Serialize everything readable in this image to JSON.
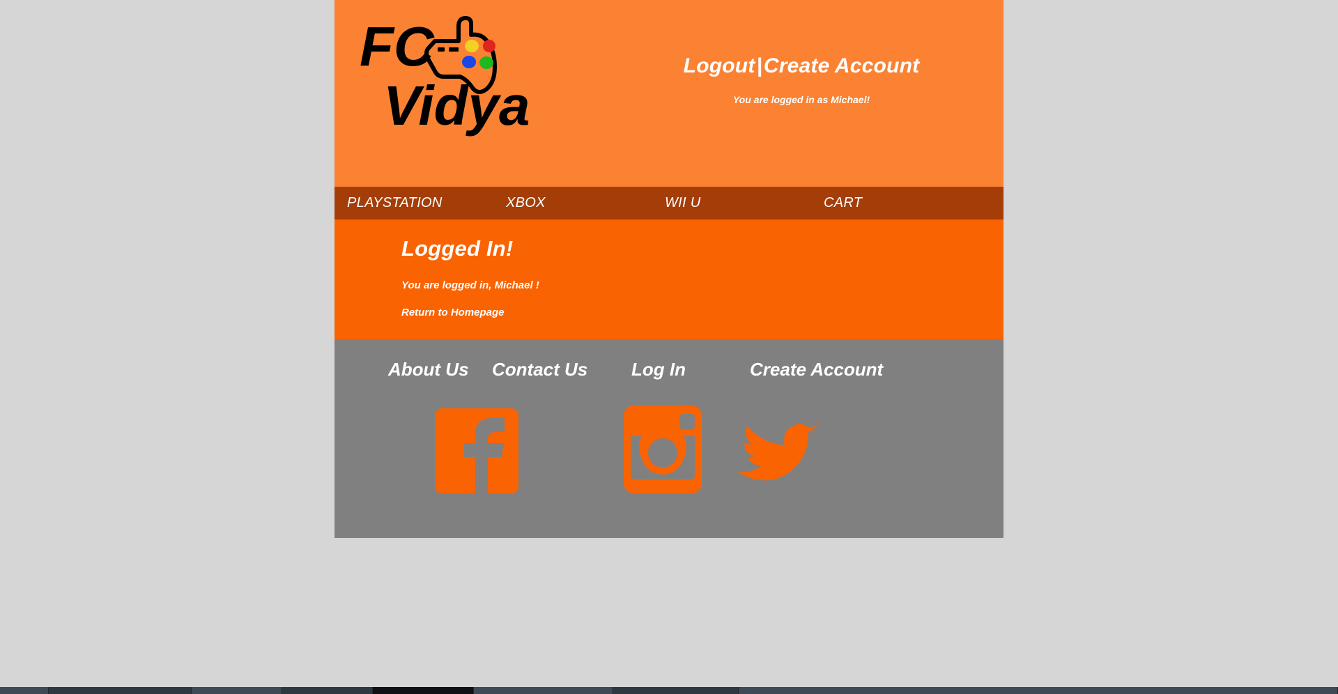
{
  "site": {
    "logo": {
      "text_top": "FC",
      "text_bottom": "Vidya",
      "icon": "game-controller-icon",
      "button_colors": [
        "#f2d024",
        "#e02420",
        "#1a46e8",
        "#1db81d"
      ],
      "text_color": "#000000"
    },
    "header": {
      "background": "#fa8232",
      "logout_label": "Logout",
      "separator": "|",
      "create_account_label": "Create Account",
      "status": "You are logged in as Michael!"
    },
    "nav": {
      "background": "#a43d08",
      "items": [
        {
          "label": "PLAYSTATION"
        },
        {
          "label": "XBOX"
        },
        {
          "label": "WII U"
        },
        {
          "label": "CART"
        }
      ]
    },
    "main": {
      "background": "#f96302",
      "heading": "Logged In!",
      "message": "You are logged in, Michael !",
      "home_link": "Return to Homepage"
    },
    "footer": {
      "background": "#808080",
      "links": [
        {
          "label": "About Us"
        },
        {
          "label": "Contact Us"
        },
        {
          "label": "Log In"
        },
        {
          "label": "Create Account"
        }
      ],
      "socials": [
        {
          "name": "facebook-icon",
          "label": "Facebook"
        },
        {
          "name": "instagram-icon",
          "label": "Instagram"
        },
        {
          "name": "twitter-icon",
          "label": "Twitter"
        }
      ],
      "social_color": "#f96302"
    },
    "page_background": "#d6d6d6"
  }
}
